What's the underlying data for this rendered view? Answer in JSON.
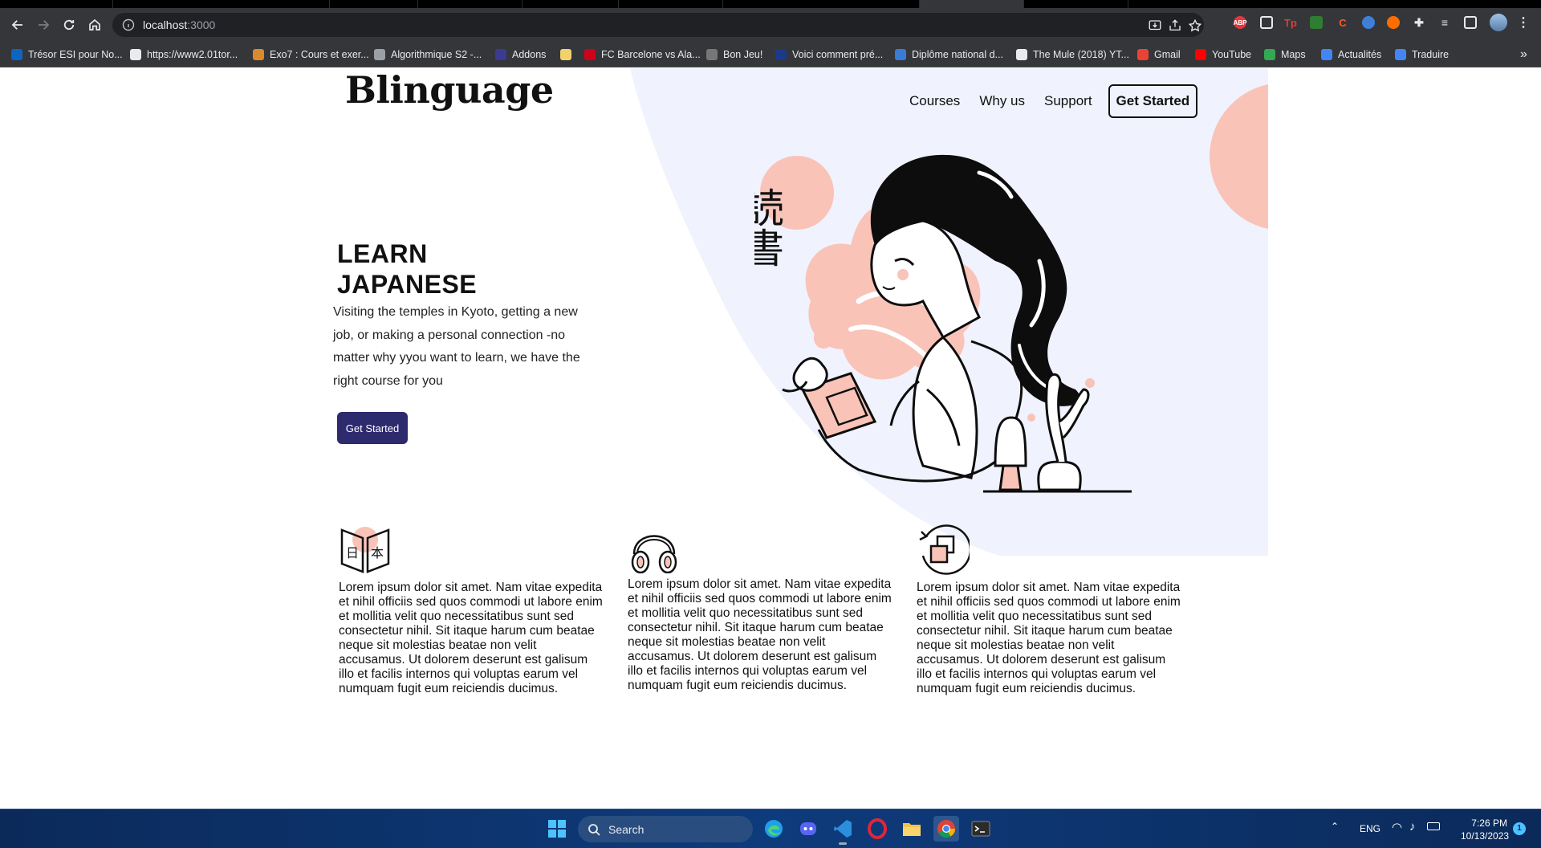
{
  "browser": {
    "url_host": "localhost",
    "url_port": ":3000",
    "bookmarks": [
      {
        "label": "Trésor ESI pour No...",
        "color": "#0a66c2"
      },
      {
        "label": "https://www2.01tor...",
        "color": "#e8eaed"
      },
      {
        "label": "Exo7 : Cours et exer...",
        "color": "#d98a2b"
      },
      {
        "label": "Algorithmique S2 -...",
        "color": "#9aa0a6"
      },
      {
        "label": "Addons",
        "color": "#3b3b8f"
      },
      {
        "label": "",
        "color": "#f2d16b"
      },
      {
        "label": "FC Barcelone vs Ala...",
        "color": "#d0021b"
      },
      {
        "label": "Bon Jeu!",
        "color": "#777777"
      },
      {
        "label": "Voici comment pré...",
        "color": "#1a3a8a"
      },
      {
        "label": "Diplôme national d...",
        "color": "#3a7bd5"
      },
      {
        "label": "The Mule (2018) YT...",
        "color": "#e8eaed"
      },
      {
        "label": "Gmail",
        "color": "#ea4335"
      },
      {
        "label": "YouTube",
        "color": "#ff0000"
      },
      {
        "label": "Maps",
        "color": "#34a853"
      },
      {
        "label": "Actualités",
        "color": "#4285f4"
      },
      {
        "label": "Traduire",
        "color": "#4285f4"
      }
    ],
    "more_bookmarks": "»",
    "extension_abp": "ABP",
    "extension_tp": "Tp"
  },
  "site": {
    "logo": "Blinguage",
    "nav": [
      "Courses",
      "Why us",
      "Support"
    ],
    "nav_cta": "Get Started",
    "hero": {
      "title": "LEARN JAPANESE",
      "text": "Visiting the temples in Kyoto, getting a new job, or making a personal connection -no matter why yyou want to learn, we have the right course for you",
      "cta": "Get Started"
    },
    "illustration_kanji": "読書",
    "features": [
      {
        "icon": "book-icon",
        "text": "Lorem ipsum dolor sit amet. Nam vitae expedita et nihil officiis sed quos commodi ut labore enim et mollitia velit quo necessitatibus sunt sed consectetur nihil. Sit itaque harum cum beatae neque sit molestias beatae non velit accusamus. Ut dolorem deserunt est galisum illo et facilis internos qui voluptas earum vel numquam fugit eum reiciendis ducimus."
      },
      {
        "icon": "headphones-icon",
        "text": "Lorem ipsum dolor sit amet. Nam vitae expedita et nihil officiis sed quos commodi ut labore enim et mollitia velit quo necessitatibus sunt sed consectetur nihil. Sit itaque harum cum beatae neque sit molestias beatae non velit accusamus. Ut dolorem deserunt est galisum illo et facilis internos qui voluptas earum vel numquam fugit eum reiciendis ducimus."
      },
      {
        "icon": "translate-icon",
        "text": "Lorem ipsum dolor sit amet. Nam vitae expedita et nihil officiis sed quos commodi ut labore enim et mollitia velit quo necessitatibus sunt sed consectetur nihil. Sit itaque harum cum beatae neque sit molestias beatae non velit accusamus. Ut dolorem deserunt est galisum illo et facilis internos qui voluptas earum vel numquam fugit eum reiciendis ducimus."
      }
    ],
    "colors": {
      "accent": "#2e2a6e",
      "pink": "#f9c3b8",
      "lavender": "#f0f2fd"
    }
  },
  "taskbar": {
    "search": "Search",
    "lang": "ENG",
    "time": "7:26 PM",
    "date": "10/13/2023",
    "notifications": "1"
  }
}
